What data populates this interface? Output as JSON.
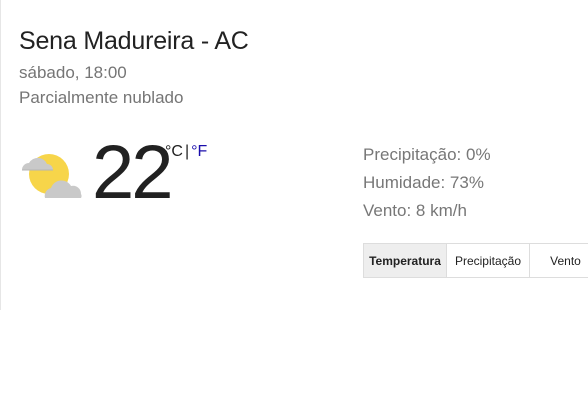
{
  "header": {
    "location": "Sena Madureira - AC",
    "datetime": "sábado, 18:00",
    "condition": "Parcialmente nublado"
  },
  "current": {
    "icon": "partly-cloudy-icon",
    "temperature": "22",
    "unit_c": "°C",
    "unit_separator": "|",
    "unit_f": "°F"
  },
  "details": {
    "precipitation": "Precipitação: 0%",
    "humidity": "Humidade: 73%",
    "wind": "Vento: 8 km/h"
  },
  "tabs": [
    {
      "label": "Temperatura",
      "active": true
    },
    {
      "label": "Precipitação",
      "active": false
    },
    {
      "label": "Vento",
      "active": false
    }
  ],
  "colors": {
    "link": "#1a0dab",
    "sun": "#f7d54a",
    "cloud": "#c9c9c9"
  }
}
